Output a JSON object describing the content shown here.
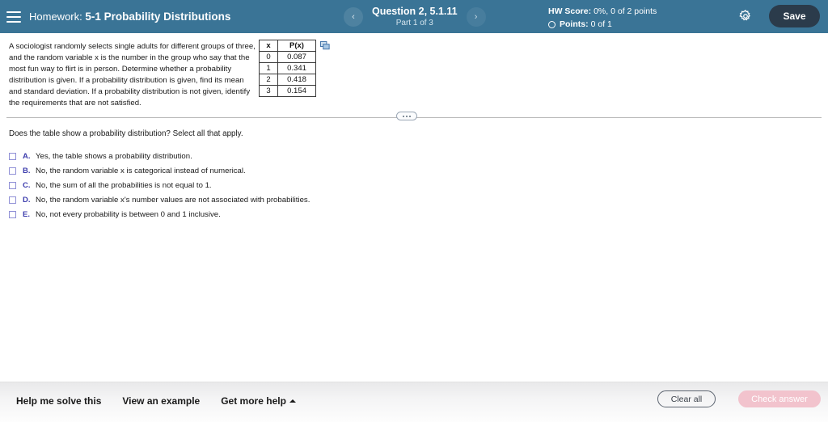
{
  "header": {
    "menu_icon": "hamburger-icon",
    "homework_label": "Homework:",
    "homework_name": "5-1 Probability Distributions",
    "prev_icon": "chevron-left-icon",
    "next_icon": "chevron-right-icon",
    "question_title": "Question 2, 5.1.11",
    "question_part": "Part 1 of 3",
    "hw_score_label": "HW Score:",
    "hw_score_value": "0%, 0 of 2 points",
    "points_label": "Points:",
    "points_value": "0 of 1",
    "settings_icon": "gear-icon",
    "save_label": "Save"
  },
  "problem": {
    "stem": "A sociologist randomly selects single adults for different groups of three, and the random variable x is the number in the group who say that the most fun way to flirt is in person. Determine whether a probability distribution is given. If a probability distribution is given, find its mean and standard deviation. If a probability distribution is not given, identify the requirements that are not satisfied.",
    "table": {
      "headers": [
        "x",
        "P(x)"
      ],
      "rows": [
        [
          "0",
          "0.087"
        ],
        [
          "1",
          "0.341"
        ],
        [
          "2",
          "0.418"
        ],
        [
          "3",
          "0.154"
        ]
      ]
    },
    "copy_icon": "copy-table-icon"
  },
  "divider": {
    "handle_icon": "drag-handle-dots-icon"
  },
  "answer": {
    "prompt": "Does the table show a probability distribution? Select all that apply.",
    "options": [
      {
        "letter": "A.",
        "text": "Yes, the table shows a probability distribution.",
        "checked": false
      },
      {
        "letter": "B.",
        "text": "No, the random variable x is categorical instead of numerical.",
        "checked": false
      },
      {
        "letter": "C.",
        "text": "No, the sum of all the probabilities is not equal to 1.",
        "checked": false
      },
      {
        "letter": "D.",
        "text": "No, the random variable x's number values are not associated with probabilities.",
        "checked": false
      },
      {
        "letter": "E.",
        "text": "No, not every probability is between 0 and 1 inclusive.",
        "checked": false
      }
    ]
  },
  "footer": {
    "help_me_solve": "Help me solve this",
    "view_example": "View an example",
    "get_more_help": "Get more help",
    "get_more_help_icon": "caret-up-icon",
    "clear_all": "Clear all",
    "check_answer": "Check answer"
  },
  "colors": {
    "header_blue": "#3a7496",
    "save_navy": "#2b3b4b",
    "option_letter_blue": "#3d3dad",
    "check_answer_pink": "#f2c3cd"
  }
}
